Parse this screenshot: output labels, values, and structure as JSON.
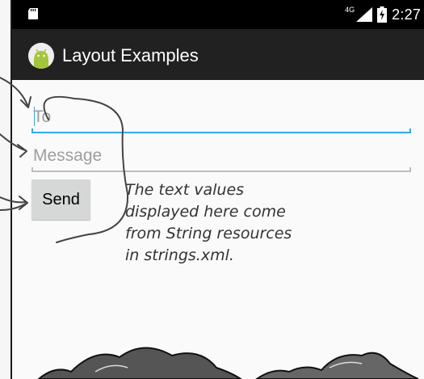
{
  "status_bar": {
    "network_label": "4G",
    "time": "2:27",
    "icons": [
      "sd-card-icon",
      "signal-icon",
      "battery-charging-icon"
    ]
  },
  "action_bar": {
    "title": "Layout Examples",
    "icon": "android-icon"
  },
  "form": {
    "to_placeholder": "To",
    "message_placeholder": "Message",
    "send_label": "Send"
  },
  "annotation": {
    "lines": [
      "The text values",
      "displayed here come",
      "from String resources",
      "in strings.xml."
    ]
  },
  "colors": {
    "accent": "#33a9e6",
    "status_bar": "#000000",
    "action_bar": "#212121",
    "button": "#d6d7d7",
    "android_green": "#a4c639"
  }
}
